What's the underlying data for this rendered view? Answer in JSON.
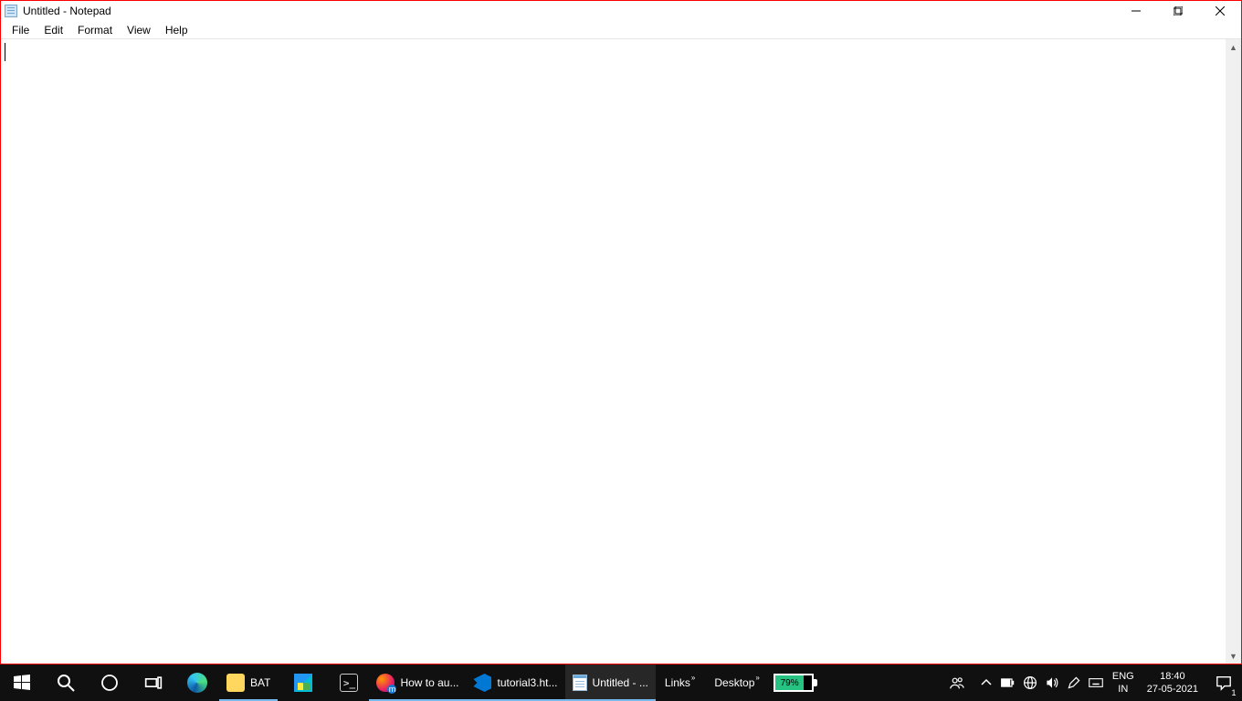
{
  "window": {
    "title": "Untitled - Notepad",
    "menu": {
      "file": "File",
      "edit": "Edit",
      "format": "Format",
      "view": "View",
      "help": "Help"
    },
    "content": ""
  },
  "taskbar": {
    "tasks": {
      "bat": {
        "label": "BAT"
      },
      "firefox": {
        "label": "How to au..."
      },
      "vscode": {
        "label": "tutorial3.ht..."
      },
      "notepad": {
        "label": "Untitled - ..."
      }
    },
    "toolbars": {
      "links": "Links",
      "desktop": "Desktop"
    },
    "battery": {
      "percent": "79%",
      "fill_pct": 79
    },
    "lang": {
      "top": "ENG",
      "bottom": "IN"
    },
    "clock": {
      "time": "18:40",
      "date": "27-05-2021"
    },
    "action_center_count": "1"
  }
}
